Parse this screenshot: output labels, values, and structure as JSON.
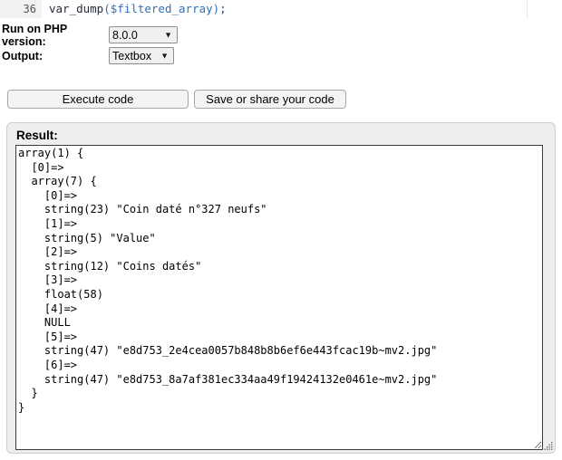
{
  "editor": {
    "line_number": "36",
    "code_tokens": [
      {
        "text": "var_dump",
        "cls": "tok-fn"
      },
      {
        "text": "(",
        "cls": "tok-punc"
      },
      {
        "text": "$filtered_array",
        "cls": "tok-var"
      },
      {
        "text": ")",
        "cls": "tok-punc"
      },
      {
        "text": ";",
        "cls": "tok-semi"
      }
    ],
    "code_plain": "var_dump($filtered_array);"
  },
  "form": {
    "php_version": {
      "label": "Run on PHP version:",
      "value": "8.0.0",
      "options": [
        "8.0.0"
      ],
      "arrow_icon": "chevron-down-icon"
    },
    "output_format": {
      "label": "Output:",
      "value": "Textbox",
      "options": [
        "Textbox"
      ],
      "arrow_icon": "chevron-down-icon"
    }
  },
  "actions": {
    "execute_label": "Execute code",
    "save_share_label": "Save or share your code"
  },
  "result": {
    "title": "Result:",
    "output": "array(1) {\n  [0]=>\n  array(7) {\n    [0]=>\n    string(23) \"Coin daté n°327 neufs\"\n    [1]=>\n    string(5) \"Value\"\n    [2]=>\n    string(12) \"Coins datés\"\n    [3]=>\n    float(58)\n    [4]=>\n    NULL\n    [5]=>\n    string(47) \"e8d753_2e4cea0057b848b8b6ef6e443fcac19b~mv2.jpg\"\n    [6]=>\n    string(47) \"e8d753_8a7af381ec334aa49f19424132e0461e~mv2.jpg\"\n  }\n}\n",
    "resize_handle_icon": "resize-grip-icon"
  },
  "colors": {
    "panel_bg": "#eeeeee",
    "panel_border": "#cfcfcf",
    "output_border": "#3a3a3a",
    "gutter_bg": "#f2f2f2",
    "code_variable": "#2f6fb8",
    "control_bg": "#f0f0f0"
  }
}
